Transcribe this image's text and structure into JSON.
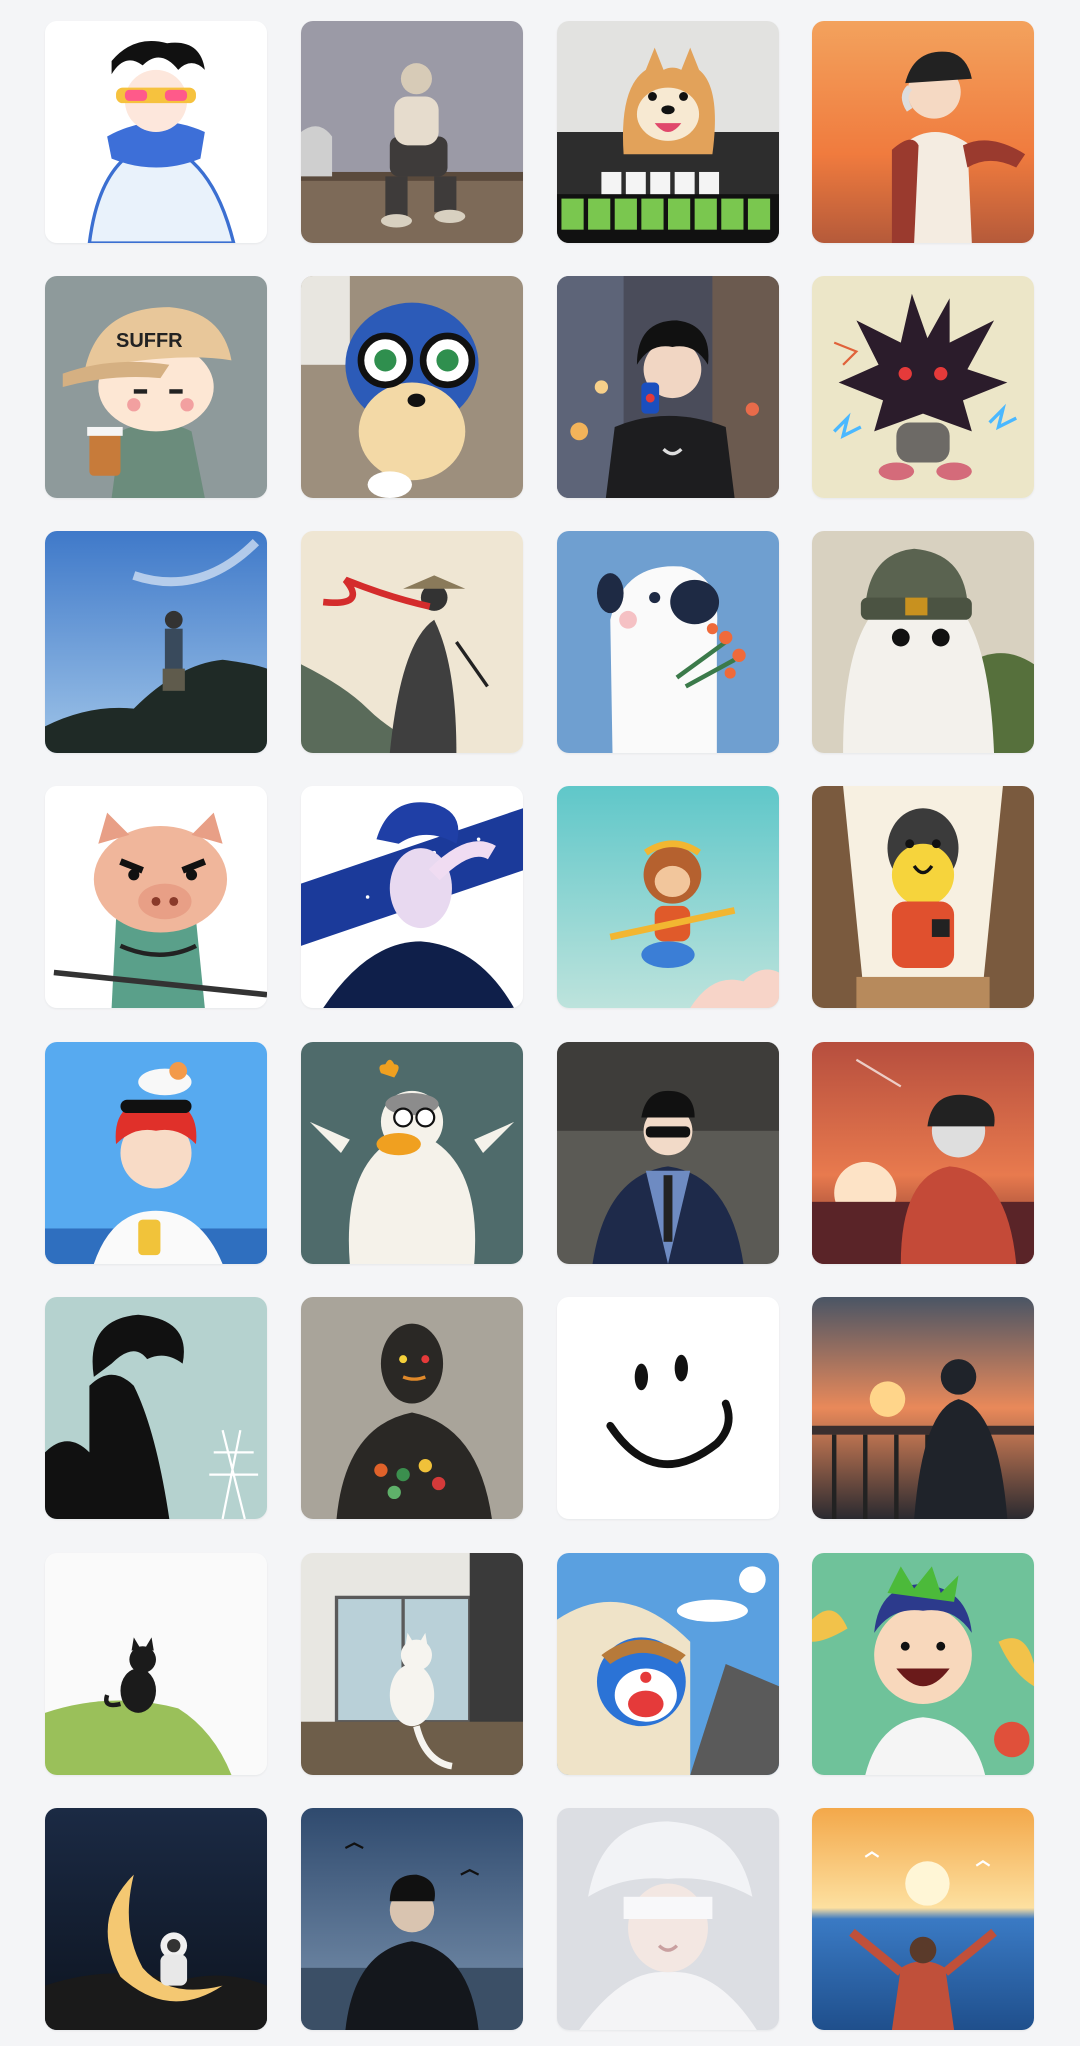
{
  "screen": {
    "name": "avatar-gallery",
    "background": "#f4f5f7"
  },
  "avatars": [
    {
      "name": "avatar-anime-boy-sunglasses-scarf",
      "icon": "anime-boy-sunglasses-icon"
    },
    {
      "name": "avatar-man-sitting-rooftop",
      "icon": "man-sitting-icon"
    },
    {
      "name": "avatar-shiba-dog-mahjong",
      "icon": "shiba-dog-icon"
    },
    {
      "name": "avatar-boy-cap-sunset-beach",
      "icon": "boy-sunset-icon"
    },
    {
      "name": "avatar-chibi-boy-cap-coffee",
      "icon": "chibi-coffee-icon"
    },
    {
      "name": "avatar-sonic-plush-glasses",
      "icon": "sonic-plush-icon"
    },
    {
      "name": "avatar-boy-soda-city-night",
      "icon": "boy-soda-icon"
    },
    {
      "name": "avatar-dark-spiky-creature",
      "icon": "spiky-creature-icon"
    },
    {
      "name": "avatar-man-on-cliff-blue-sky",
      "icon": "cliff-man-icon"
    },
    {
      "name": "avatar-ink-samurai-red-scarf",
      "icon": "samurai-icon"
    },
    {
      "name": "avatar-white-dog-flowers",
      "icon": "white-dog-icon"
    },
    {
      "name": "avatar-ghost-beanie-sunglasses",
      "icon": "ghost-icon"
    },
    {
      "name": "avatar-angry-pig-warrior",
      "icon": "pig-warrior-icon"
    },
    {
      "name": "avatar-galaxy-hair-boy",
      "icon": "galaxy-boy-icon"
    },
    {
      "name": "avatar-monkey-king-cloud",
      "icon": "monkey-king-icon"
    },
    {
      "name": "avatar-penguin-window",
      "icon": "penguin-icon"
    },
    {
      "name": "avatar-red-hair-boy-cat",
      "icon": "red-hair-boy-icon"
    },
    {
      "name": "avatar-duck-penguin-heart",
      "icon": "duck-icon"
    },
    {
      "name": "avatar-man-suit-sunglasses",
      "icon": "suit-man-icon"
    },
    {
      "name": "avatar-hoodie-boy-red-sunset",
      "icon": "hoodie-boy-icon"
    },
    {
      "name": "avatar-dark-hair-boy-silhouette",
      "icon": "silhouette-boy-icon"
    },
    {
      "name": "avatar-shadow-figure-wall",
      "icon": "shadow-figure-icon"
    },
    {
      "name": "avatar-smiley-face",
      "icon": "smiley-icon"
    },
    {
      "name": "avatar-man-sunset-railing",
      "icon": "sunset-railing-icon"
    },
    {
      "name": "avatar-black-cat-hill",
      "icon": "black-cat-icon"
    },
    {
      "name": "avatar-white-cat-window",
      "icon": "white-cat-icon"
    },
    {
      "name": "avatar-doraemon-car",
      "icon": "doraemon-icon"
    },
    {
      "name": "avatar-green-hair-laughing-boy",
      "icon": "laughing-boy-icon"
    },
    {
      "name": "avatar-astronaut-crescent-moon",
      "icon": "astronaut-moon-icon"
    },
    {
      "name": "avatar-man-seaside-birds",
      "icon": "seaside-man-icon"
    },
    {
      "name": "avatar-white-hair-blindfold",
      "icon": "blindfold-icon"
    },
    {
      "name": "avatar-open-arms-sea-sunrise",
      "icon": "open-arms-icon"
    }
  ],
  "colors": {
    "sky_blue": "#5b8fd6",
    "sunset_orange": "#f08a4b",
    "paper": "#f1ead9"
  }
}
